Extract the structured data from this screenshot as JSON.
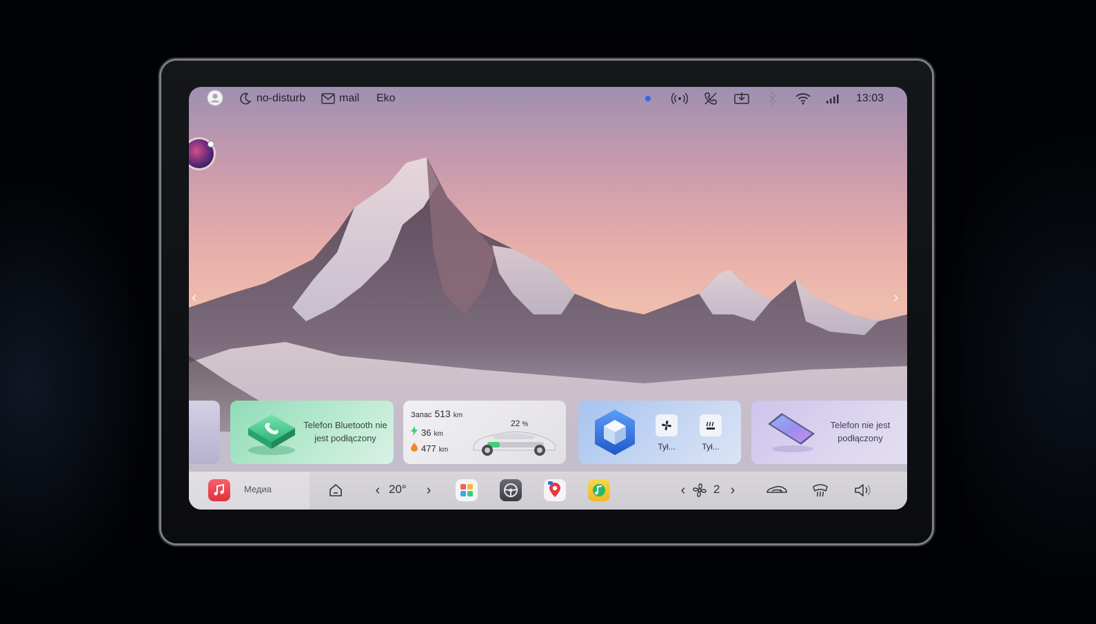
{
  "status_bar": {
    "no_disturb_label": "no-disturb",
    "mail_label": "mail",
    "mode_label": "Eko",
    "time": "13:03",
    "icons": [
      "user-icon",
      "moon-icon",
      "mail-icon",
      "dot-indicator-icon",
      "broadcast-icon",
      "no-call-icon",
      "screen-cast-icon",
      "bluetooth-icon",
      "wifi-icon",
      "signal-icon"
    ]
  },
  "cards": {
    "phone_bluetooth": {
      "text_line1": "Telefon Bluetooth nie",
      "text_line2": "jest podłączony"
    },
    "range": {
      "range_label": "Запас",
      "range_value": "513",
      "range_unit": "km",
      "electric_value": "36",
      "electric_unit": "km",
      "fuel_value": "477",
      "fuel_unit": "km",
      "battery_percent": "22",
      "battery_unit": "%",
      "battery_level": 0.22
    },
    "controls": {
      "button1_label": "Tył...",
      "button2_label": "Tył..."
    },
    "phone_projection": {
      "text_line1": "Telefon nie jest",
      "text_line2": "podłączony"
    }
  },
  "dock": {
    "media_label": "Медиа",
    "temperature": "20°",
    "fan_level": "2"
  },
  "colors": {
    "music_app": "#f0424e",
    "battery_green": "#3ecf7a",
    "fuel_orange": "#f08a2a",
    "cube_blue": "#3f7fe6"
  }
}
